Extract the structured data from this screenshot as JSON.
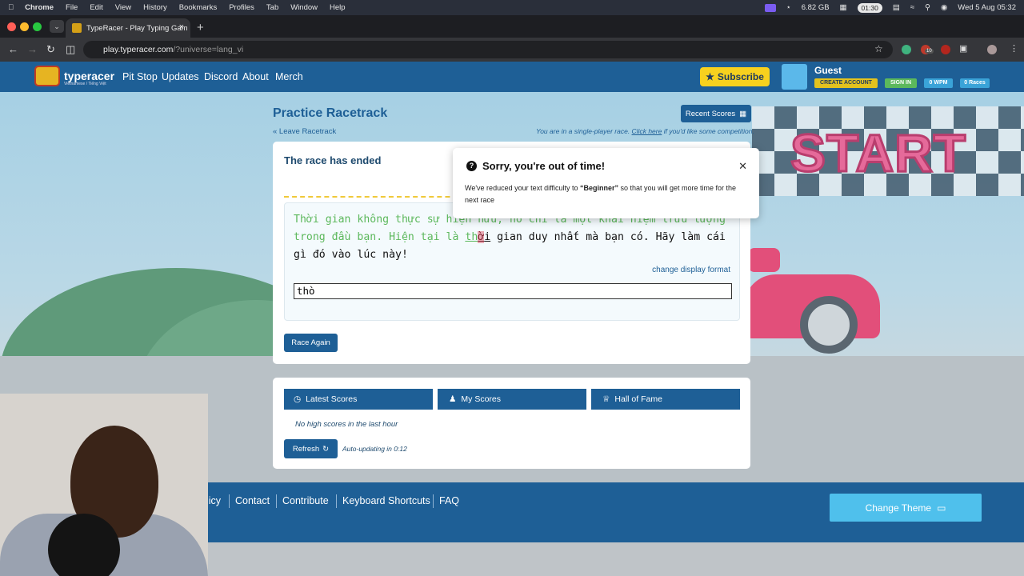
{
  "menubar": {
    "app": "Chrome",
    "items": [
      "File",
      "Edit",
      "View",
      "History",
      "Bookmarks",
      "Profiles",
      "Tab",
      "Window",
      "Help"
    ],
    "memory": "6.82 GB",
    "timer": "01:30",
    "datetime": "Wed 5 Aug  05:32"
  },
  "browser": {
    "tab_title": "TypeRacer - Play Typing Gam",
    "url_main": "play.typeracer.com",
    "url_rest": "/?universe=lang_vi",
    "ext_badge": "10"
  },
  "site": {
    "logo_text": "typeracer",
    "logo_sub": "Vietnamese / Tiếng Việt",
    "nav": [
      "Pit Stop",
      "Updates",
      "Discord",
      "About",
      "Merch"
    ],
    "subscribe": "Subscribe",
    "user": "Guest",
    "create_account": "CREATE ACCOUNT",
    "sign_in": "SIGN IN",
    "wpm": "0 WPM",
    "races": "0 Races"
  },
  "practice": {
    "title": "Practice Racetrack",
    "recent_scores": "Recent Scores",
    "leave": "« Leave Racetrack",
    "single_pre": "You are in a single-player race. ",
    "single_link": "Click here",
    "single_post": " if you'd like some competition."
  },
  "race": {
    "status": "The race has ended",
    "typed_text": "Thời gian không thực sự hiện hữu, nó chỉ là một khái niệm trừu tượng trong đầu bạn. Hiện tại là ",
    "current_before_error": "th",
    "error_char": "ờ",
    "current_after_error": "i",
    "remaining_text": " gian duy nhất mà bạn có. Hãy làm cái gì đó vào lúc này!",
    "change_format": "change display format",
    "input_value": "thò",
    "race_again": "Race Again"
  },
  "popup": {
    "title": "Sorry, you're out of time!",
    "msg_pre": "We've reduced your text difficulty to ",
    "msg_bold": "“Beginner”",
    "msg_post": " so that you will get more time for the next race"
  },
  "scores": {
    "tabs": [
      "Latest Scores",
      "My Scores",
      "Hall of Fame"
    ],
    "empty": "No high scores in the last hour",
    "refresh": "Refresh",
    "auto": "Auto-updating in 0:12"
  },
  "footer": {
    "links": [
      "licy",
      "Contact",
      "Contribute",
      "Keyboard Shortcuts",
      "FAQ"
    ],
    "change_theme": "Change Theme"
  },
  "background": {
    "start_sign": "START"
  },
  "colors": {
    "brand_blue": "#1e5f96",
    "subscribe_yellow": "#f7d11e",
    "typed_green": "#5cb85c",
    "error_pink": "#e9a9b3",
    "theme_button": "#4fc0ec"
  }
}
